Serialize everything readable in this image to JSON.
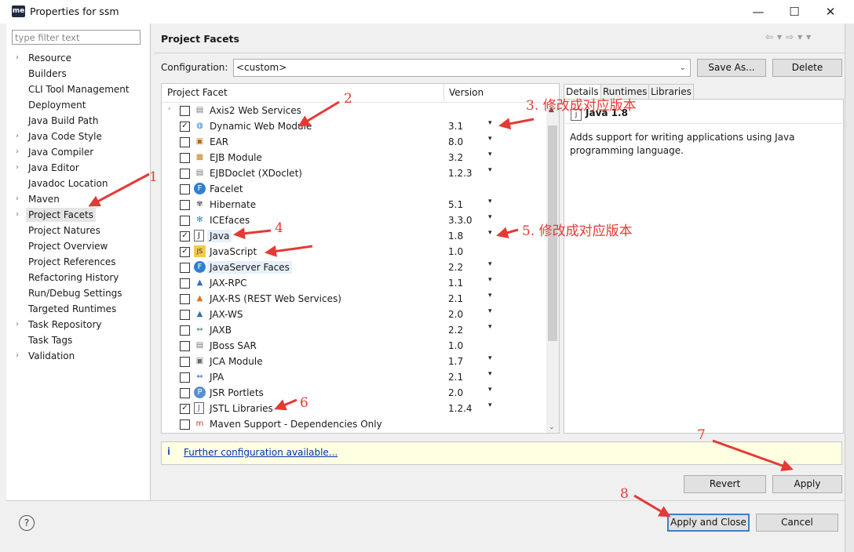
{
  "window": {
    "title": "Properties for ssm",
    "app_icon_text": "me",
    "minimize": "—",
    "maximize": "☐",
    "close": "✕"
  },
  "filter": {
    "placeholder": "type filter text"
  },
  "nav": {
    "items": [
      {
        "label": "Resource",
        "expandable": true
      },
      {
        "label": "Builders",
        "expandable": false
      },
      {
        "label": "CLI Tool Management",
        "expandable": false
      },
      {
        "label": "Deployment",
        "expandable": false
      },
      {
        "label": "Java Build Path",
        "expandable": false
      },
      {
        "label": "Java Code Style",
        "expandable": true
      },
      {
        "label": "Java Compiler",
        "expandable": true
      },
      {
        "label": "Java Editor",
        "expandable": true
      },
      {
        "label": "Javadoc Location",
        "expandable": false
      },
      {
        "label": "Maven",
        "expandable": true
      },
      {
        "label": "Project Facets",
        "expandable": true,
        "selected": true
      },
      {
        "label": "Project Natures",
        "expandable": false
      },
      {
        "label": "Project Overview",
        "expandable": false
      },
      {
        "label": "Project References",
        "expandable": false
      },
      {
        "label": "Refactoring History",
        "expandable": false
      },
      {
        "label": "Run/Debug Settings",
        "expandable": false
      },
      {
        "label": "Targeted Runtimes",
        "expandable": false
      },
      {
        "label": "Task Repository",
        "expandable": true
      },
      {
        "label": "Task Tags",
        "expandable": false
      },
      {
        "label": "Validation",
        "expandable": true
      }
    ]
  },
  "page": {
    "title": "Project Facets",
    "nav_arrows": "⇦▾⇨▾▾"
  },
  "config": {
    "label": "Configuration:",
    "value": "<custom>",
    "save_as": "Save As...",
    "delete": "Delete"
  },
  "table": {
    "col_facet": "Project Facet",
    "col_version": "Version",
    "rows": [
      {
        "label": "Axis2 Web Services",
        "version": "",
        "checked": false,
        "expandable": true,
        "icon": "doc-icon",
        "dropdown": false
      },
      {
        "label": "Dynamic Web Module",
        "version": "3.1",
        "checked": true,
        "icon": "web-module-icon",
        "dropdown": true
      },
      {
        "label": "EAR",
        "version": "8.0",
        "checked": false,
        "icon": "ear-icon",
        "dropdown": true
      },
      {
        "label": "EJB Module",
        "version": "3.2",
        "checked": false,
        "icon": "ejb-icon",
        "dropdown": true
      },
      {
        "label": "EJBDoclet (XDoclet)",
        "version": "1.2.3",
        "checked": false,
        "icon": "doc-icon",
        "dropdown": true
      },
      {
        "label": "Facelet",
        "version": "",
        "checked": false,
        "icon": "faces-icon",
        "dropdown": false
      },
      {
        "label": "Hibernate",
        "version": "5.1",
        "checked": false,
        "icon": "hibernate-icon",
        "dropdown": true
      },
      {
        "label": "ICEfaces",
        "version": "3.3.0",
        "checked": false,
        "icon": "icefaces-icon",
        "dropdown": true
      },
      {
        "label": "Java",
        "version": "1.8",
        "checked": true,
        "icon": "java-icon",
        "dropdown": true,
        "highlight": true
      },
      {
        "label": "JavaScript",
        "version": "1.0",
        "checked": true,
        "icon": "javascript-icon",
        "dropdown": false
      },
      {
        "label": "JavaServer Faces",
        "version": "2.2",
        "checked": false,
        "icon": "faces-icon",
        "dropdown": true,
        "highlight": true
      },
      {
        "label": "JAX-RPC",
        "version": "1.1",
        "checked": false,
        "icon": "jax-icon",
        "dropdown": true
      },
      {
        "label": "JAX-RS (REST Web Services)",
        "version": "2.1",
        "checked": false,
        "icon": "jaxrs-icon",
        "dropdown": true
      },
      {
        "label": "JAX-WS",
        "version": "2.0",
        "checked": false,
        "icon": "jax-icon",
        "dropdown": true
      },
      {
        "label": "JAXB",
        "version": "2.2",
        "checked": false,
        "icon": "jaxb-icon",
        "dropdown": true
      },
      {
        "label": "JBoss SAR",
        "version": "1.0",
        "checked": false,
        "icon": "doc-icon",
        "dropdown": false
      },
      {
        "label": "JCA Module",
        "version": "1.7",
        "checked": false,
        "icon": "jca-icon",
        "dropdown": true
      },
      {
        "label": "JPA",
        "version": "2.1",
        "checked": false,
        "icon": "jpa-icon",
        "dropdown": true
      },
      {
        "label": "JSR Portlets",
        "version": "2.0",
        "checked": false,
        "icon": "portlet-icon",
        "dropdown": true
      },
      {
        "label": "JSTL Libraries",
        "version": "1.2.4",
        "checked": true,
        "icon": "jstl-icon",
        "dropdown": true
      },
      {
        "label": "Maven Support - Dependencies Only",
        "version": "",
        "checked": false,
        "icon": "maven-icon",
        "dropdown": false
      }
    ]
  },
  "details": {
    "tabs": [
      "Details",
      "Runtimes",
      "Libraries"
    ],
    "title": "Java 1.8",
    "icon_glyph": "J",
    "description": "Adds support for writing applications using Java programming language."
  },
  "info": {
    "icon": "i",
    "link": "Further configuration available..."
  },
  "buttons": {
    "revert": "Revert",
    "apply": "Apply",
    "apply_close": "Apply and Close",
    "cancel": "Cancel",
    "help": "?"
  },
  "annotations": [
    {
      "text": "1"
    },
    {
      "text": "2"
    },
    {
      "text": "3. 修改成对应版本"
    },
    {
      "text": "4"
    },
    {
      "text": "5. 修改成对应版本"
    },
    {
      "text": "6"
    },
    {
      "text": "7"
    },
    {
      "text": "8"
    }
  ],
  "colors": {
    "annotation": "#e53935",
    "link": "#0033aa",
    "default_button_border": "#3c7fc8",
    "info_bg": "#ffffe1"
  }
}
